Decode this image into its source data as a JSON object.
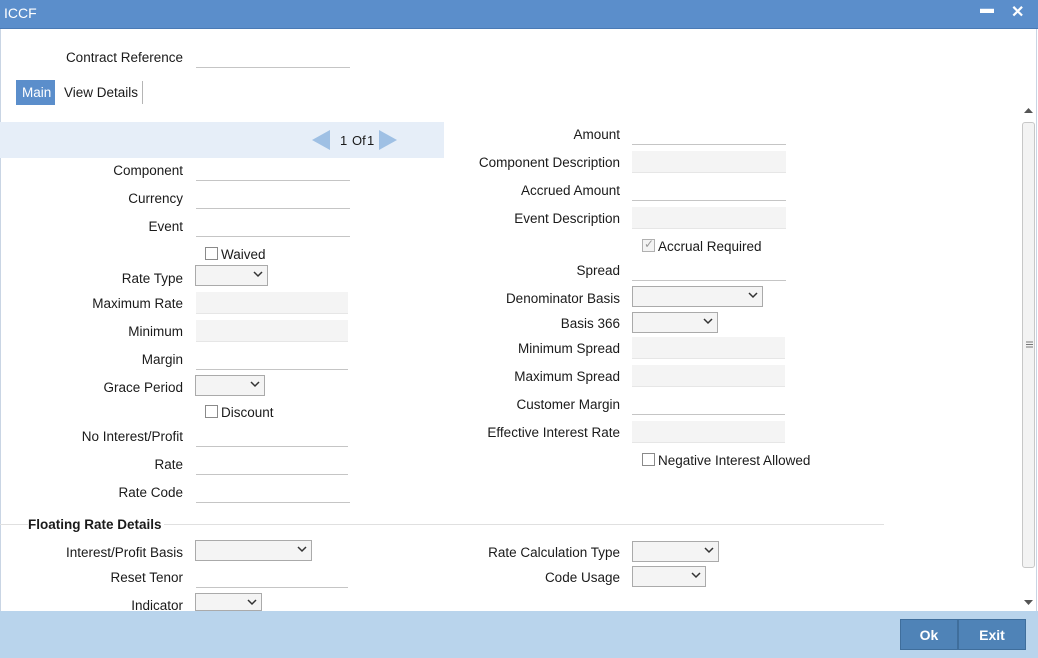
{
  "window": {
    "title": "ICCF",
    "minimize_glyph": "▬",
    "close_glyph": "✕"
  },
  "header": {
    "contract_reference_label": "Contract Reference",
    "contract_reference_value": ""
  },
  "tabs": [
    {
      "label": "Main",
      "active": true
    },
    {
      "label": "View Details",
      "active": false
    }
  ],
  "pager": {
    "current": "1",
    "of_label": "Of",
    "total": "1"
  },
  "left": {
    "component_label": "Component",
    "currency_label": "Currency",
    "event_label": "Event",
    "waived_label": "Waived",
    "rate_type_label": "Rate Type",
    "maximum_rate_label": "Maximum Rate",
    "minimum_label": "Minimum",
    "margin_label": "Margin",
    "grace_period_label": "Grace Period",
    "discount_label": "Discount",
    "no_interest_label": "No Interest/Profit",
    "rate_label": "Rate",
    "rate_code_label": "Rate Code"
  },
  "right": {
    "amount_label": "Amount",
    "component_description_label": "Component Description",
    "accrued_amount_label": "Accrued Amount",
    "event_description_label": "Event Description",
    "accrual_required_label": "Accrual Required",
    "accrual_required_checked": true,
    "spread_label": "Spread",
    "denominator_basis_label": "Denominator Basis",
    "basis_366_label": "Basis 366",
    "minimum_spread_label": "Minimum Spread",
    "maximum_spread_label": "Maximum Spread",
    "customer_margin_label": "Customer Margin",
    "effective_interest_rate_label": "Effective Interest Rate",
    "negative_interest_label": "Negative Interest Allowed"
  },
  "floating": {
    "section_title": "Floating Rate Details",
    "interest_basis_label": "Interest/Profit Basis",
    "reset_tenor_label": "Reset Tenor",
    "indicator_label": "Indicator",
    "rate_calc_type_label": "Rate Calculation Type",
    "code_usage_label": "Code Usage"
  },
  "footer": {
    "ok_label": "Ok",
    "exit_label": "Exit"
  },
  "colors": {
    "titlebar": "#5b8ecb",
    "footer": "#b9d4ec",
    "button": "#4f83b7",
    "nav_strip": "#e6eef8"
  }
}
